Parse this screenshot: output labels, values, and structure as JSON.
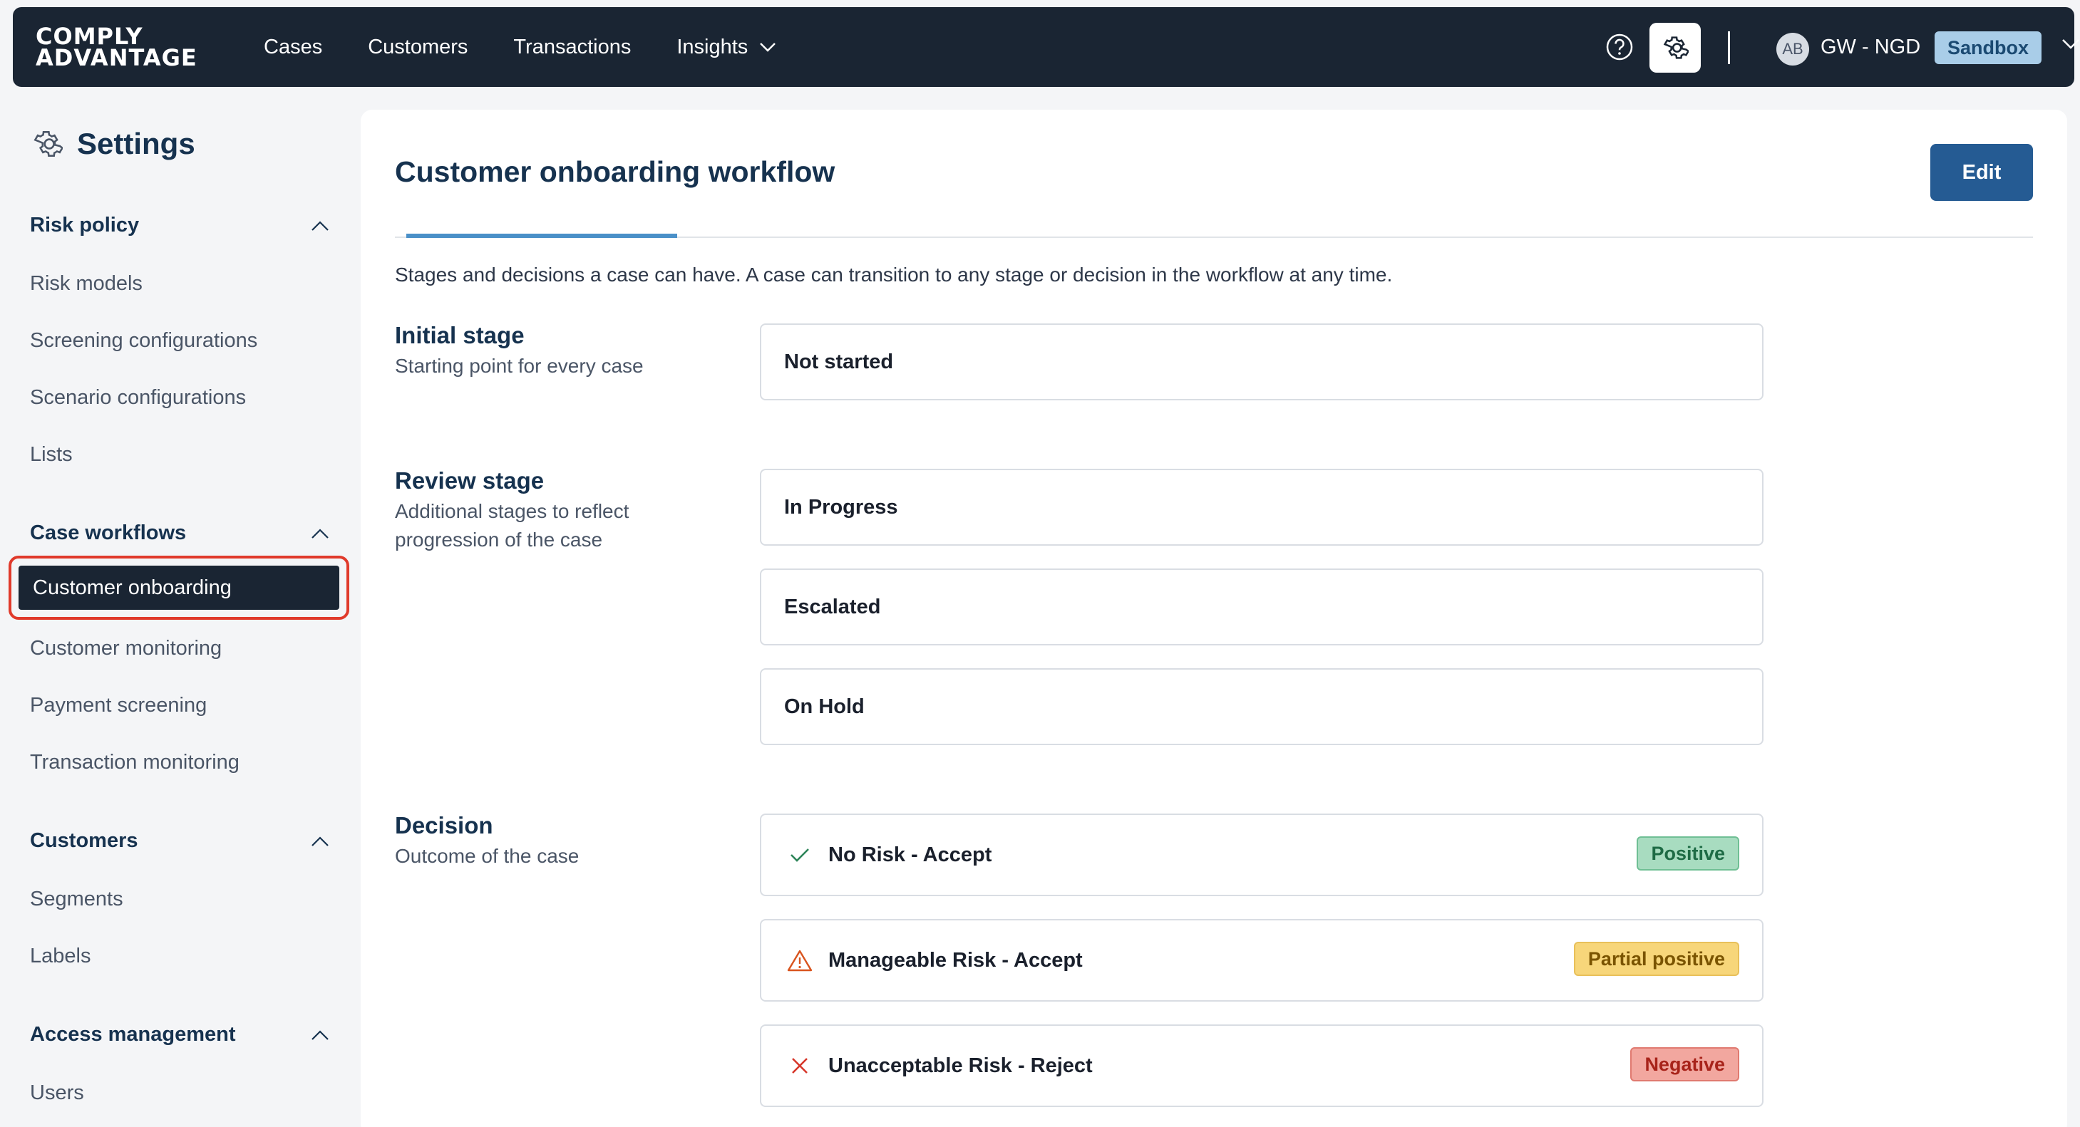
{
  "brand": {
    "logo_line1": "COMPLY",
    "logo_line2": "ADVANTAGE"
  },
  "nav": {
    "items": [
      {
        "label": "Cases"
      },
      {
        "label": "Customers"
      },
      {
        "label": "Transactions"
      },
      {
        "label": "Insights"
      }
    ]
  },
  "user": {
    "initials": "AB",
    "org": "GW - NGD",
    "environment": "Sandbox"
  },
  "sidebar": {
    "title": "Settings",
    "sections": [
      {
        "title": "Risk policy",
        "items": [
          "Risk models",
          "Screening configurations",
          "Scenario configurations",
          "Lists"
        ]
      },
      {
        "title": "Case workflows",
        "items": [
          "Customer onboarding",
          "Customer monitoring",
          "Payment screening",
          "Transaction monitoring"
        ]
      },
      {
        "title": "Customers",
        "items": [
          "Segments",
          "Labels"
        ]
      },
      {
        "title": "Access management",
        "items": [
          "Users"
        ]
      }
    ]
  },
  "main": {
    "title": "Customer onboarding workflow",
    "edit_label": "Edit",
    "description": "Stages and decisions a case can have. A case can transition to any stage or decision in the workflow at any time.",
    "initial_stage": {
      "title": "Initial stage",
      "subtitle": "Starting point for every case",
      "stages": [
        "Not started"
      ]
    },
    "review_stage": {
      "title": "Review stage",
      "subtitle": "Additional stages to reflect progression of the case",
      "stages": [
        "In Progress",
        "Escalated",
        "On Hold"
      ]
    },
    "decision": {
      "title": "Decision",
      "subtitle": "Outcome of the case",
      "items": [
        {
          "label": "No Risk - Accept",
          "badge": "Positive",
          "icon": "check-icon"
        },
        {
          "label": "Manageable Risk - Accept",
          "badge": "Partial positive",
          "icon": "warning-triangle-icon"
        },
        {
          "label": "Unacceptable Risk - Reject",
          "badge": "Negative",
          "icon": "close-x-icon"
        }
      ]
    }
  },
  "colors": {
    "nav_bg": "#1a2533",
    "accent": "#255b93",
    "highlight_border": "#e03a2b",
    "positive_bg": "#a8dcc0",
    "partial_bg": "#f7d67a",
    "negative_bg": "#f2a79f"
  }
}
